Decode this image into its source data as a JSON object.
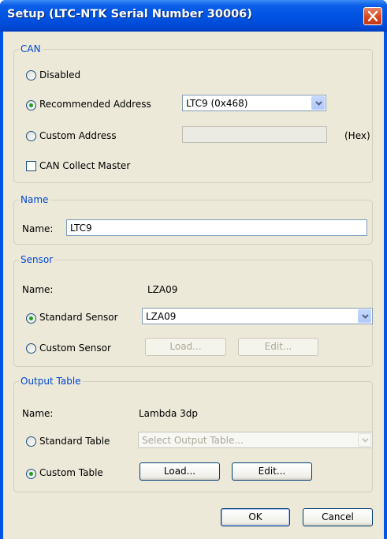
{
  "window": {
    "title": "Setup (LTC-NTK Serial Number 30006)"
  },
  "can": {
    "legend": "CAN",
    "disabled_label": "Disabled",
    "recommended_label": "Recommended Address",
    "recommended_value": "LTC9 (0x468)",
    "custom_label": "Custom Address",
    "custom_value": "",
    "hex_label": "(Hex)",
    "collect_master_label": "CAN Collect Master",
    "selected": "recommended",
    "collect_master_checked": false
  },
  "name_section": {
    "legend": "Name",
    "label": "Name:",
    "value": "LTC9"
  },
  "sensor": {
    "legend": "Sensor",
    "name_label": "Name:",
    "name_value": "LZA09",
    "standard_label": "Standard Sensor",
    "standard_value": "LZA09",
    "custom_label": "Custom Sensor",
    "load_label": "Load...",
    "edit_label": "Edit...",
    "selected": "standard"
  },
  "output_table": {
    "legend": "Output Table",
    "name_label": "Name:",
    "name_value": "Lambda 3dp",
    "standard_label": "Standard Table",
    "standard_placeholder": "Select Output Table...",
    "custom_label": "Custom Table",
    "load_label": "Load...",
    "edit_label": "Edit...",
    "selected": "custom"
  },
  "footer": {
    "ok_label": "OK",
    "cancel_label": "Cancel"
  },
  "colors": {
    "title_bar": "#0054e3",
    "legend_text": "#0046d5",
    "client_bg": "#ece9d8",
    "close_button": "#d5471f"
  }
}
